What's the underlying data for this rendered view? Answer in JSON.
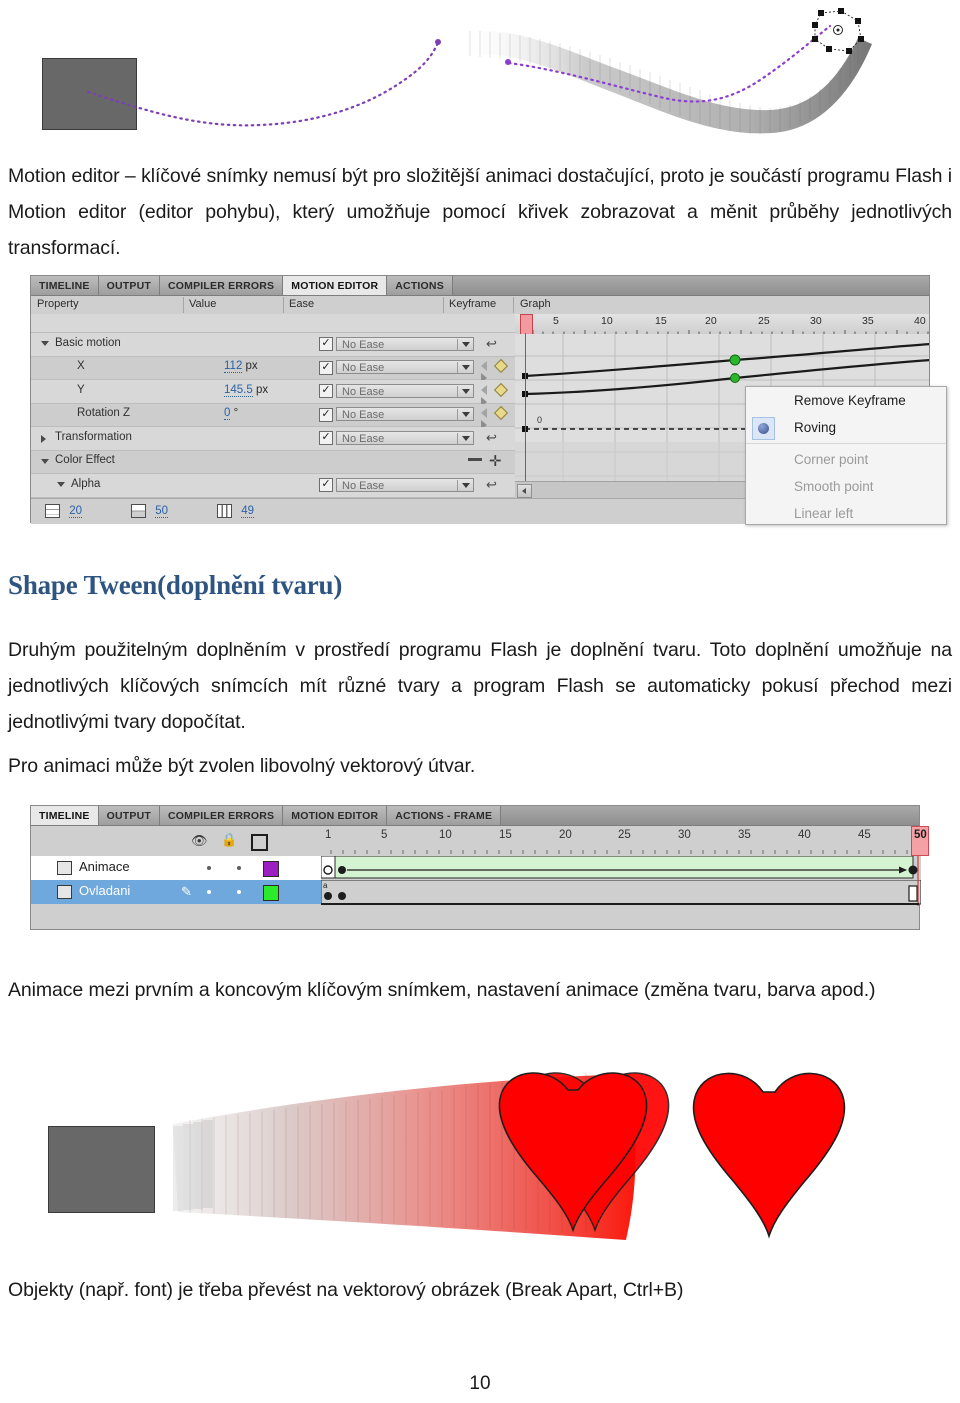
{
  "document": {
    "page_number": "10",
    "paragraphs": [
      {
        "id": "intro",
        "text": "Motion editor – klíčové snímky nemusí být pro složitější animaci dostačující, proto je součástí programu Flash i Motion editor (editor pohybu), který umožňuje pomocí křivek zobrazovat a měnit průběhy jednotlivých transformací."
      },
      {
        "id": "shape-tween-body",
        "text": "Druhým použitelným doplněním v prostředí programu Flash je doplnění tvaru. Toto doplnění umožňuje na jednotlivých klíčových snímcích mít různé tvary a program Flash se automaticky pokusí přechod mezi jednotlivými tvary dopočítat."
      },
      {
        "id": "vector-note",
        "text": "Pro animaci může být zvolen libovolný vektorový útvar."
      },
      {
        "id": "timeline-caption",
        "text": "Animace mezi prvním a koncovým klíčovým snímkem, nastavení animace (změna tvaru, barva apod.)"
      },
      {
        "id": "break-apart-note",
        "text": "Objekty (např. font) je třeba převést na vektorový obrázek (Break Apart, Ctrl+B)"
      }
    ],
    "heading": "Shape Tween(doplnění tvaru)",
    "heading_color": "#2e5481"
  },
  "motion_editor": {
    "tabs": [
      {
        "label": "TIMELINE",
        "active": false
      },
      {
        "label": "OUTPUT",
        "active": false
      },
      {
        "label": "COMPILER ERRORS",
        "active": false
      },
      {
        "label": "MOTION EDITOR",
        "active": true
      },
      {
        "label": "ACTIONS",
        "active": false
      }
    ],
    "columns": {
      "property": "Property",
      "value": "Value",
      "ease": "Ease",
      "keyframe": "Keyframe",
      "graph": "Graph"
    },
    "rows": [
      {
        "name": "Basic motion",
        "indent": 0,
        "twisty": "down",
        "value": "",
        "unit": "",
        "checkbox": true,
        "ease": "No Ease",
        "keyframe_nav": false,
        "reset": true
      },
      {
        "name": "X",
        "indent": 1,
        "twisty": "none",
        "value": "112",
        "unit": " px",
        "checkbox": true,
        "ease": "No Ease",
        "keyframe_nav": true,
        "reset": false
      },
      {
        "name": "Y",
        "indent": 1,
        "twisty": "none",
        "value": "145.5",
        "unit": " px",
        "checkbox": true,
        "ease": "No Ease",
        "keyframe_nav": true,
        "reset": false
      },
      {
        "name": "Rotation Z",
        "indent": 1,
        "twisty": "none",
        "value": "0",
        "unit": " °",
        "checkbox": true,
        "ease": "No Ease",
        "keyframe_nav": true,
        "reset": false
      },
      {
        "name": "Transformation",
        "indent": 0,
        "twisty": "right",
        "value": "",
        "unit": "",
        "checkbox": true,
        "ease": "No Ease",
        "keyframe_nav": false,
        "reset": true
      },
      {
        "name": "Color Effect",
        "indent": 0,
        "twisty": "down",
        "value": "",
        "unit": "",
        "checkbox": false,
        "ease": "",
        "keyframe_nav": false,
        "reset": false
      },
      {
        "name": "Alpha",
        "indent": 1,
        "twisty": "down",
        "value": "",
        "unit": "",
        "checkbox": true,
        "ease": "No Ease",
        "keyframe_nav": false,
        "reset": true
      }
    ],
    "bottom_bar": [
      {
        "icon": "graph-size-icon",
        "value": "20"
      },
      {
        "icon": "expanded-graph-size-icon",
        "value": "50"
      },
      {
        "icon": "viewable-frames-icon",
        "value": "49"
      }
    ],
    "ruler_ticks": [
      "5",
      "10",
      "15",
      "20",
      "25",
      "30",
      "35",
      "40"
    ],
    "playhead_frame": "1"
  },
  "context_menu": {
    "items": [
      {
        "label": "Remove Keyframe",
        "disabled": false,
        "selected": false
      },
      {
        "label": "Roving",
        "disabled": false,
        "selected": true
      },
      {
        "label": "Corner point",
        "disabled": true,
        "selected": false
      },
      {
        "label": "Smooth point",
        "disabled": true,
        "selected": false
      },
      {
        "label": "Linear left",
        "disabled": true,
        "selected": false
      }
    ]
  },
  "timeline": {
    "tabs": [
      {
        "label": "TIMELINE",
        "active": true
      },
      {
        "label": "OUTPUT",
        "active": false
      },
      {
        "label": "COMPILER ERRORS",
        "active": false
      },
      {
        "label": "MOTION EDITOR",
        "active": false
      },
      {
        "label": "ACTIONS - FRAME",
        "active": false
      }
    ],
    "header_icons": [
      {
        "name": "eye-icon",
        "glyph": "👁"
      },
      {
        "name": "lock-icon",
        "glyph": "🔒"
      },
      {
        "name": "outline-square-icon",
        "glyph": "▢"
      }
    ],
    "ruler_ticks": [
      "1",
      "5",
      "10",
      "15",
      "20",
      "25",
      "30",
      "35",
      "40",
      "45",
      "50"
    ],
    "playhead_frame": "50",
    "layers": [
      {
        "name": "Animace",
        "selected": false,
        "color": "#9b1fc1",
        "editing": false
      },
      {
        "name": "Ovladani",
        "selected": true,
        "color": "#2aea2a",
        "editing": true
      }
    ]
  },
  "figures": {
    "motion_tween": {
      "name": "motion-tween-illustration",
      "description": "Square motion tween along dotted purple path with onion-skin ghost trail"
    },
    "shape_tween": {
      "name": "shape-tween-illustration",
      "description": "Grey square morphing into red heart with onion-skin frames"
    }
  }
}
